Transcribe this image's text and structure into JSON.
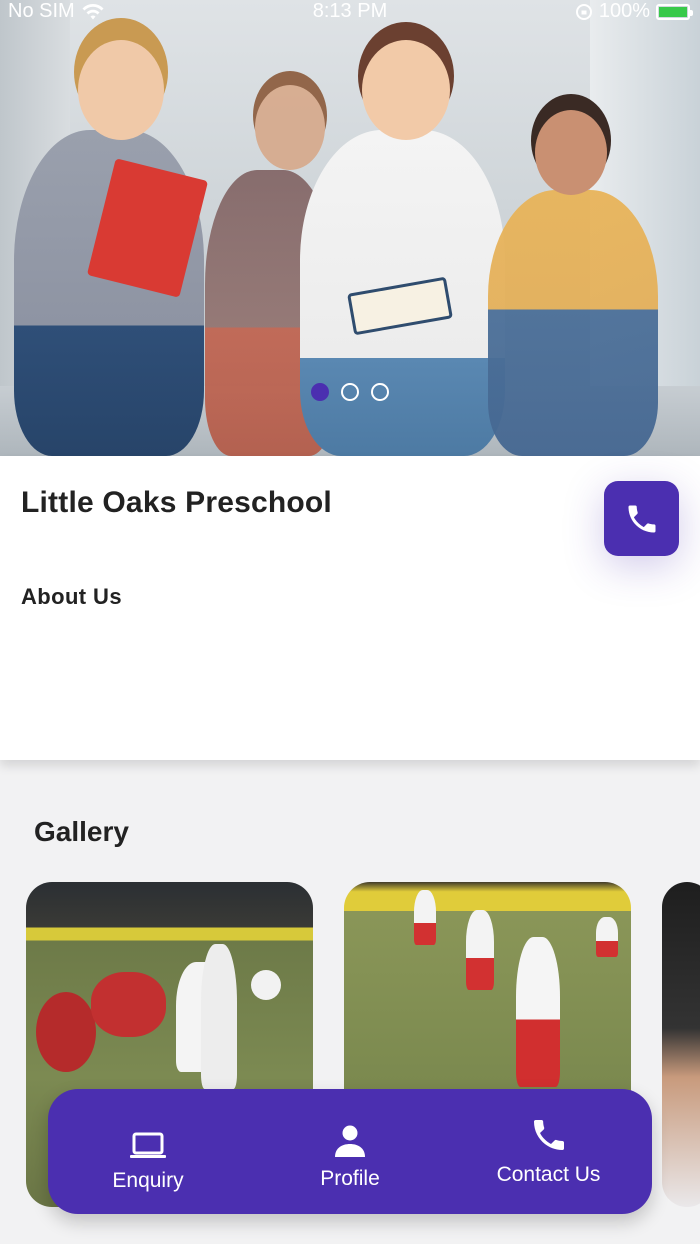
{
  "status_bar": {
    "carrier": "No SIM",
    "time": "8:13 PM",
    "battery": "100%"
  },
  "hero": {
    "slides": 3,
    "active_slide": 1,
    "image": "children-with-books-in-school-hallway"
  },
  "school": {
    "name": "Little Oaks Preschool",
    "about_heading": "About Us",
    "call_icon": "phone-icon"
  },
  "gallery": {
    "title": "Gallery",
    "images": [
      "sports-day-tricycles",
      "sports-day-children-running",
      "child-portrait"
    ]
  },
  "bottom_nav": {
    "items": [
      {
        "label": "Enquiry",
        "icon": "laptop-icon"
      },
      {
        "label": "Profile",
        "icon": "person-icon"
      },
      {
        "label": "Contact Us",
        "icon": "phone-icon"
      }
    ]
  },
  "colors": {
    "accent": "#4b2fb0",
    "background": "#f2f2f3",
    "card": "#ffffff",
    "text": "#222222"
  }
}
